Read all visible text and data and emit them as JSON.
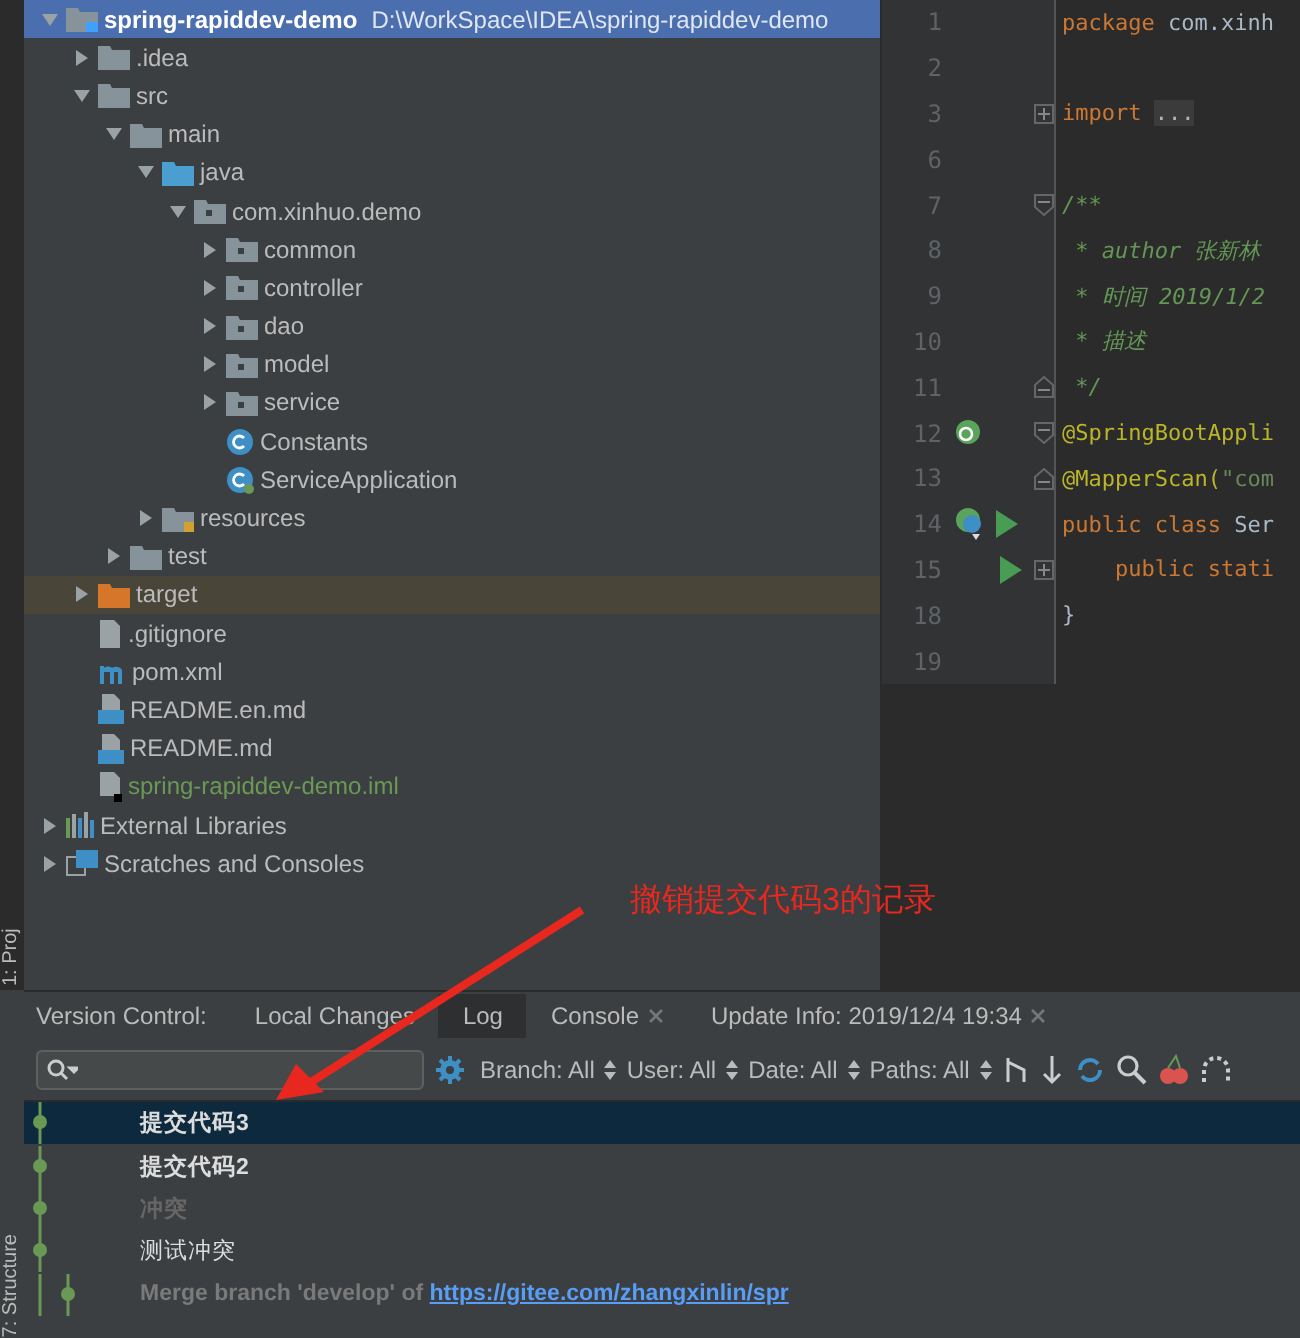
{
  "side_strip": {
    "top_label": "1: Proj",
    "bottom_label": "7: Structure"
  },
  "project_tree": [
    {
      "label": "spring-rapiddev-demo",
      "path": "D:\\WorkSpace\\IDEA\\spring-rapiddev-demo",
      "kind": "module",
      "expanded": true,
      "selected": true,
      "children": [
        {
          "label": ".idea",
          "kind": "folder",
          "expanded": false,
          "selected": false
        },
        {
          "label": "src",
          "kind": "folder",
          "expanded": true,
          "selected": false,
          "children": [
            {
              "label": "main",
              "kind": "folder",
              "expanded": true,
              "selected": false,
              "children": [
                {
                  "label": "java",
                  "kind": "source",
                  "expanded": true,
                  "selected": false,
                  "children": [
                    {
                      "label": "com.xinhuo.demo",
                      "kind": "package",
                      "expanded": true,
                      "selected": false,
                      "children": [
                        {
                          "label": "common",
                          "kind": "package",
                          "expanded": false,
                          "selected": false
                        },
                        {
                          "label": "controller",
                          "kind": "package",
                          "expanded": false,
                          "selected": false
                        },
                        {
                          "label": "dao",
                          "kind": "package",
                          "expanded": false,
                          "selected": false
                        },
                        {
                          "label": "model",
                          "kind": "package",
                          "expanded": false,
                          "selected": false
                        },
                        {
                          "label": "service",
                          "kind": "package",
                          "expanded": false,
                          "selected": false
                        },
                        {
                          "label": "Constants",
                          "kind": "class",
                          "selected": false
                        },
                        {
                          "label": "ServiceApplication",
                          "kind": "spring-class",
                          "selected": false
                        }
                      ]
                    }
                  ]
                },
                {
                  "label": "resources",
                  "kind": "resources",
                  "expanded": false,
                  "selected": false
                }
              ]
            },
            {
              "label": "test",
              "kind": "folder",
              "expanded": false,
              "selected": false
            }
          ]
        },
        {
          "label": "target",
          "kind": "excluded",
          "expanded": false,
          "selected": false
        },
        {
          "label": ".gitignore",
          "kind": "file",
          "selected": false
        },
        {
          "label": "pom.xml",
          "kind": "maven",
          "selected": false
        },
        {
          "label": "README.en.md",
          "kind": "markdown",
          "selected": false
        },
        {
          "label": "README.md",
          "kind": "markdown",
          "selected": false
        },
        {
          "label": "spring-rapiddev-demo.iml",
          "kind": "iml",
          "selected": false
        }
      ]
    },
    {
      "label": "External Libraries",
      "kind": "libraries",
      "expanded": false,
      "selected": false
    },
    {
      "label": "Scratches and Consoles",
      "kind": "scratches",
      "expanded": false,
      "selected": false
    }
  ],
  "editor": {
    "lines": [
      {
        "number": "1",
        "tokens": [
          {
            "text": "package ",
            "kind": "keyword"
          },
          {
            "text": "com.xinh",
            "kind": "plain"
          }
        ]
      },
      {
        "number": "2"
      },
      {
        "number": "3",
        "fold_marker": {
          "kind": "collapsed"
        },
        "tokens": [
          {
            "text": "import ",
            "kind": "keyword"
          },
          {
            "text": "...",
            "kind": "folded"
          }
        ]
      },
      {
        "number": "6"
      },
      {
        "number": "7",
        "fold_marker": {
          "kind": "open"
        },
        "tokens": [
          {
            "text": "/**",
            "kind": "comment"
          }
        ]
      },
      {
        "number": "8",
        "tokens": [
          {
            "text": " * ",
            "kind": "comment"
          },
          {
            "text": "author ",
            "kind": "comment"
          },
          {
            "text": "张新林",
            "kind": "comment"
          }
        ]
      },
      {
        "number": "9",
        "tokens": [
          {
            "text": " * 时间 ",
            "kind": "comment"
          },
          {
            "text": "2019/1/2",
            "kind": "comment"
          }
        ]
      },
      {
        "number": "10",
        "tokens": [
          {
            "text": " * 描述",
            "kind": "comment"
          }
        ]
      },
      {
        "number": "11",
        "fold_marker": {
          "kind": "close"
        },
        "tokens": [
          {
            "text": " */",
            "kind": "comment"
          }
        ]
      },
      {
        "number": "12",
        "gutter_icon": {
          "kind": "bean"
        },
        "fold_marker": {
          "kind": "open"
        },
        "tokens": [
          {
            "text": "@SpringBootAppli",
            "kind": "annotation"
          }
        ]
      },
      {
        "number": "13",
        "fold_marker": {
          "kind": "close"
        },
        "tokens": [
          {
            "text": "@MapperScan(",
            "kind": "annotation"
          },
          {
            "text": "\"com",
            "kind": "string"
          }
        ]
      },
      {
        "number": "14",
        "gutter_icon": {
          "kind": "class-run"
        },
        "tokens": [
          {
            "text": "public class ",
            "kind": "keyword"
          },
          {
            "text": "Ser",
            "kind": "plain"
          }
        ]
      },
      {
        "number": "15",
        "gutter_icon": {
          "kind": "run"
        },
        "fold_marker": {
          "kind": "collapsed"
        },
        "tokens": [
          {
            "text": "    public stati",
            "kind": "keyword"
          }
        ]
      },
      {
        "number": "18",
        "tokens": [
          {
            "text": "}",
            "kind": "plain"
          }
        ]
      },
      {
        "number": "19"
      }
    ]
  },
  "annotation": {
    "text": "撤销提交代码3的记录"
  },
  "bottom_panel": {
    "title": "Version Control:",
    "tabs": [
      {
        "label": "Local Changes",
        "selected": false,
        "closable": false
      },
      {
        "label": "Log",
        "selected": true,
        "closable": false
      },
      {
        "label": "Console",
        "selected": false,
        "closable": true
      },
      {
        "label": "Update Info: 2019/12/4 19:34",
        "selected": false,
        "closable": true
      }
    ],
    "filters": [
      "Branch: All",
      "User: All",
      "Date: All",
      "Paths: All"
    ],
    "commits": [
      {
        "message": "提交代码3",
        "kind": "bold",
        "selected": true
      },
      {
        "message": "提交代码2",
        "kind": "bold",
        "selected": false
      },
      {
        "message": "冲突",
        "kind": "dim",
        "selected": false
      },
      {
        "message": "测试冲突",
        "kind": "normal",
        "selected": false
      },
      {
        "message": "Merge branch 'develop' of ",
        "link": "https://gitee.com/zhangxinlin/spr",
        "kind": "merge",
        "selected": false
      }
    ]
  }
}
